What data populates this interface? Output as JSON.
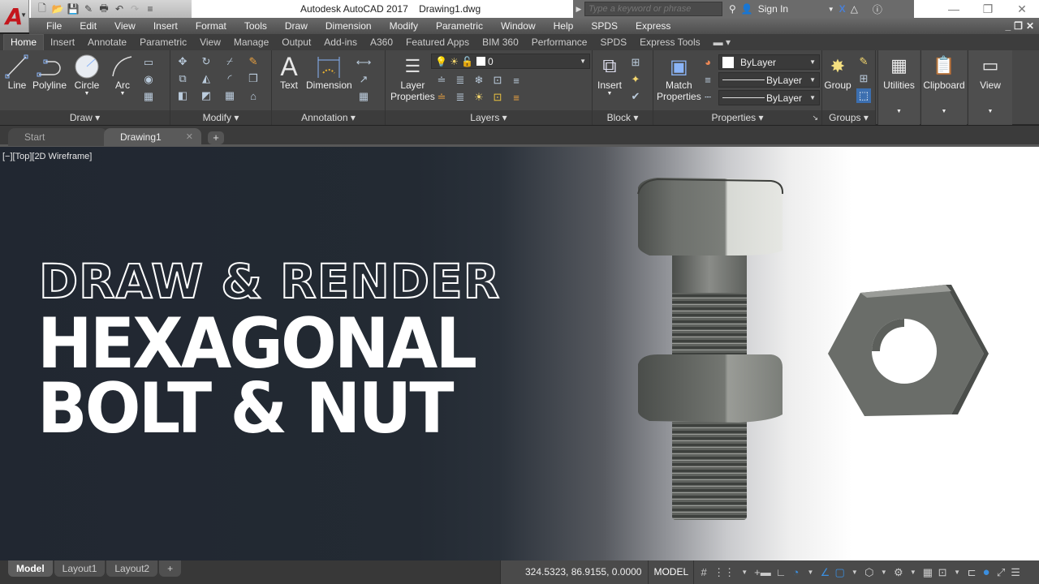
{
  "window": {
    "app_title": "Autodesk AutoCAD 2017",
    "file_name": "Drawing1.dwg",
    "app_button_letter": "A",
    "search_placeholder": "Type a keyword or phrase",
    "sign_in": "Sign In"
  },
  "qat_icons": [
    "new-icon",
    "open-icon",
    "save-icon",
    "save-as-icon",
    "plot-icon",
    "undo-icon",
    "redo-icon",
    "customize-icon"
  ],
  "menubar": [
    "File",
    "Edit",
    "View",
    "Insert",
    "Format",
    "Tools",
    "Draw",
    "Dimension",
    "Modify",
    "Parametric",
    "Window",
    "Help",
    "SPDS",
    "Express"
  ],
  "ribbon_tabs": [
    "Home",
    "Insert",
    "Annotate",
    "Parametric",
    "View",
    "Manage",
    "Output",
    "Add-ins",
    "A360",
    "Featured Apps",
    "BIM 360",
    "Performance",
    "SPDS",
    "Express Tools"
  ],
  "ribbon_active_tab": "Home",
  "ribbon": {
    "draw": {
      "title": "Draw",
      "buttons": [
        "Line",
        "Polyline",
        "Circle",
        "Arc"
      ]
    },
    "modify": {
      "title": "Modify"
    },
    "annotation": {
      "title": "Annotation",
      "buttons": [
        "Text",
        "Dimension"
      ]
    },
    "layers": {
      "title": "Layers",
      "button": "Layer",
      "button2": "Properties",
      "current_layer": "0"
    },
    "block": {
      "title": "Block",
      "button": "Insert"
    },
    "properties": {
      "title": "Properties",
      "button": "Match",
      "button2": "Properties",
      "color": "ByLayer",
      "linetype": "ByLayer",
      "lineweight": "ByLayer"
    },
    "groups": {
      "title": "Groups",
      "button": "Group"
    },
    "utilities": "Utilities",
    "clipboard": "Clipboard",
    "view": "View"
  },
  "doc_tabs": {
    "start": "Start",
    "active": "Drawing1",
    "add": "+"
  },
  "viewport": {
    "label": "[−][Top][2D Wireframe]",
    "headline1": "DRAW & RENDER",
    "headline2": "HEXAGONAL",
    "headline3": "BOLT & NUT"
  },
  "layout_tabs": [
    "Model",
    "Layout1",
    "Layout2",
    "+"
  ],
  "status": {
    "coordinates": "324.5323, 86.9155, 0.0000",
    "space": "MODEL"
  },
  "colors": {
    "accent_red": "#c4161c",
    "accent_blue": "#3b8fe0"
  }
}
